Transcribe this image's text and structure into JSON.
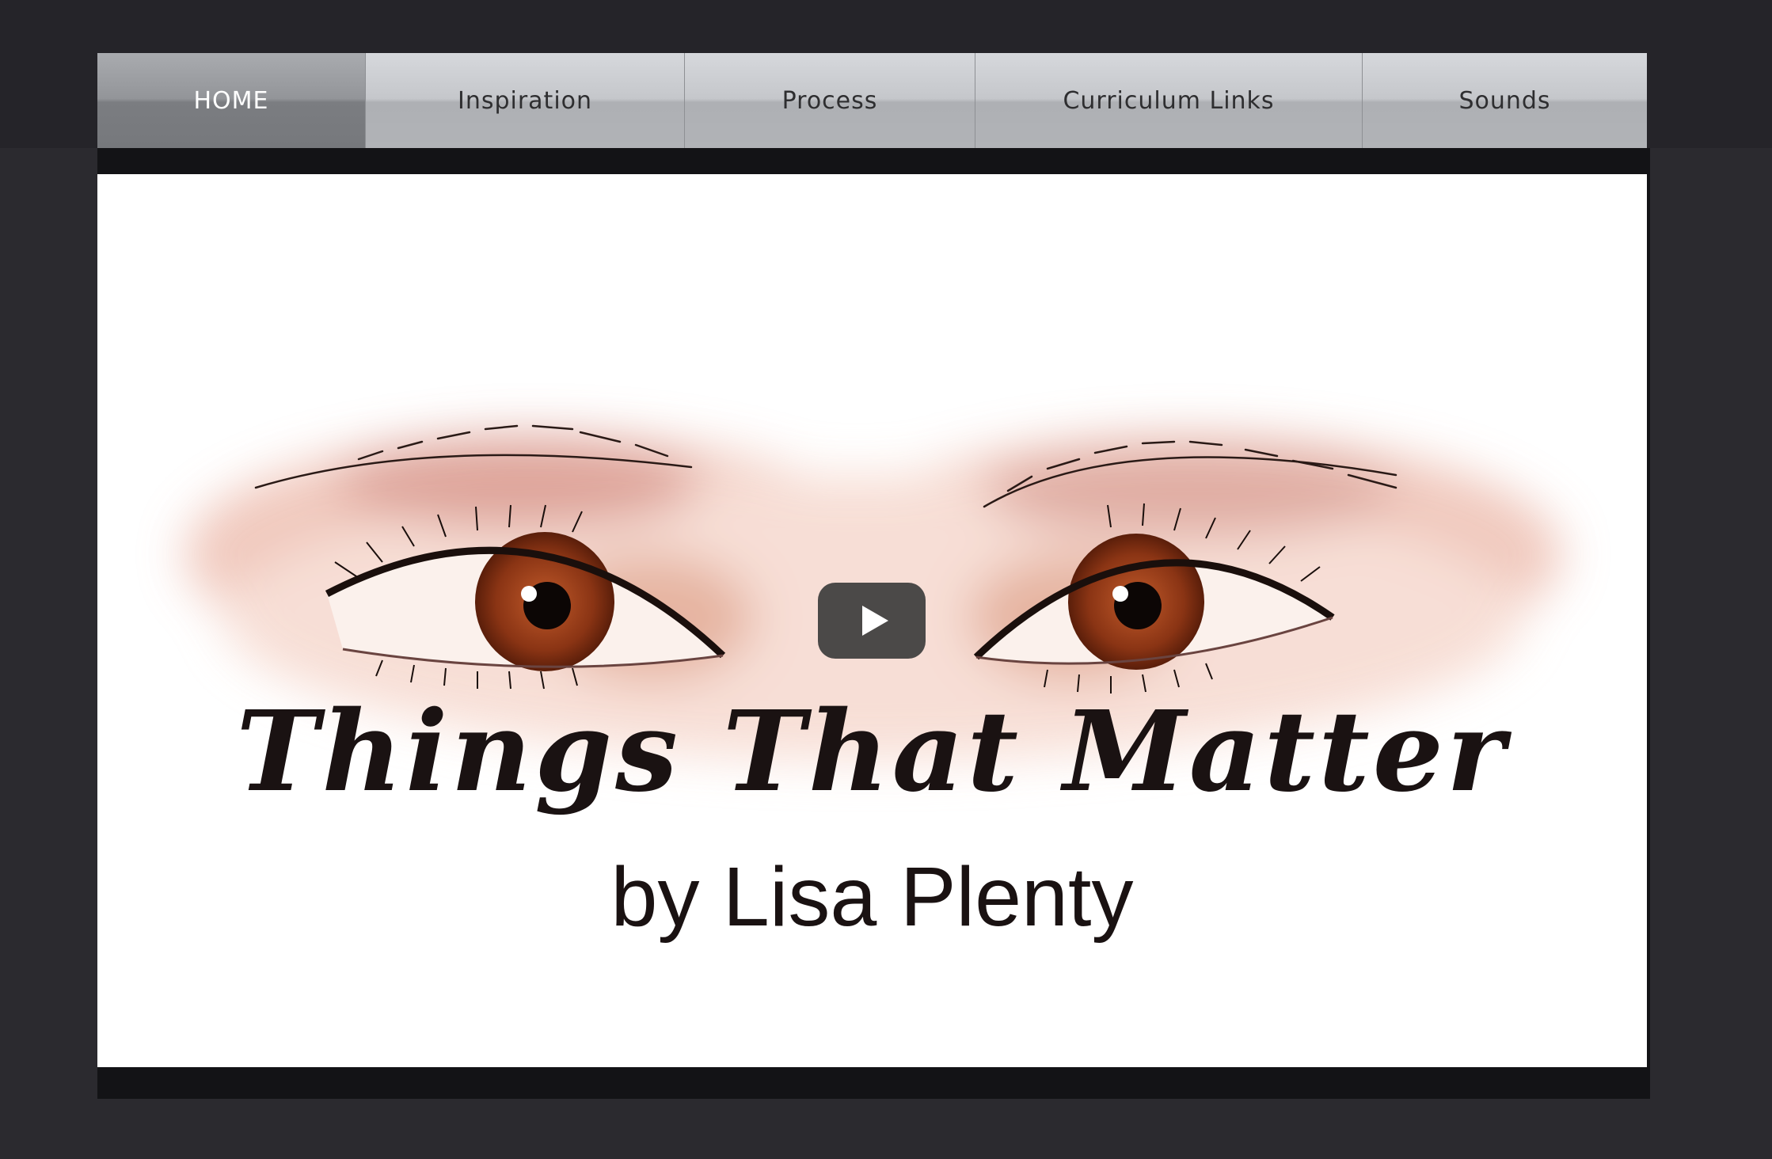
{
  "nav": {
    "items": [
      {
        "label": "HOME",
        "active": true
      },
      {
        "label": "Inspiration",
        "active": false
      },
      {
        "label": "Process",
        "active": false
      },
      {
        "label": "Curriculum Links",
        "active": false
      },
      {
        "label": "Sounds",
        "active": false
      }
    ]
  },
  "video": {
    "title_text": "Things That Matter",
    "byline": "by Lisa Plenty",
    "play_icon": "play-icon",
    "iris_color": "#8a3414",
    "skin_wash_color": "#e8b3a4"
  }
}
